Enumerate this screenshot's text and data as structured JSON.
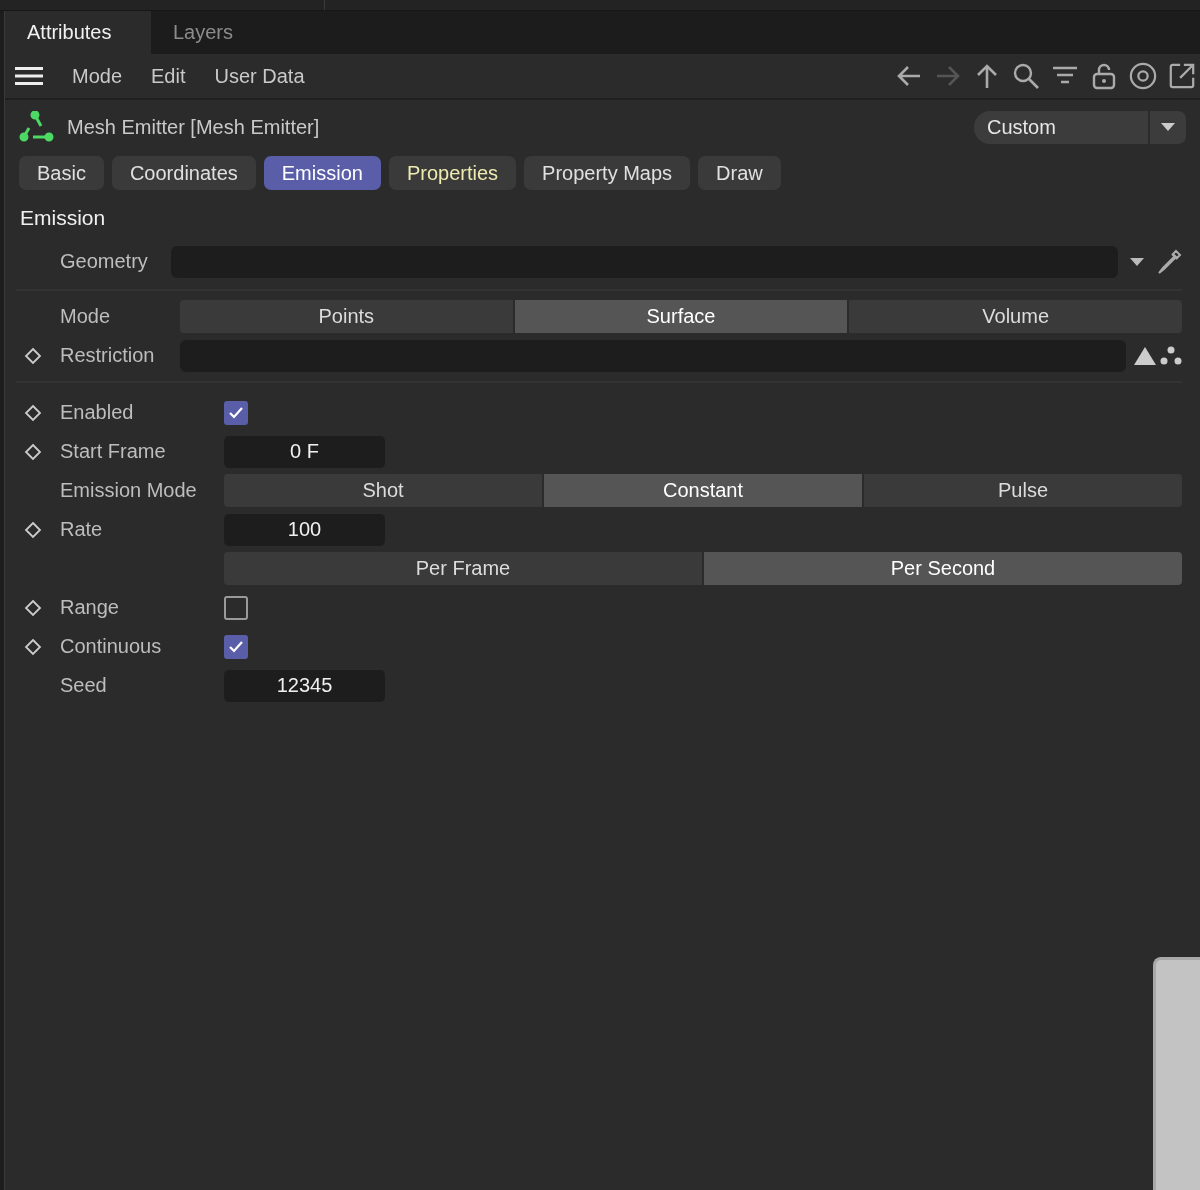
{
  "panel_tabs": [
    {
      "label": "Attributes",
      "selected": true
    },
    {
      "label": "Layers",
      "selected": false
    }
  ],
  "menu": [
    "Mode",
    "Edit",
    "User Data"
  ],
  "object": {
    "title": "Mesh Emitter [Mesh Emitter]",
    "preset": "Custom"
  },
  "tabs": [
    {
      "label": "Basic",
      "selected": false,
      "modified": false
    },
    {
      "label": "Coordinates",
      "selected": false,
      "modified": false
    },
    {
      "label": "Emission",
      "selected": true,
      "modified": false
    },
    {
      "label": "Properties",
      "selected": false,
      "modified": true
    },
    {
      "label": "Property Maps",
      "selected": false,
      "modified": false
    },
    {
      "label": "Draw",
      "selected": false,
      "modified": false
    }
  ],
  "section": "Emission",
  "groups": [
    [
      {
        "kind": "picker_link",
        "label": "Geometry",
        "keyframe": false
      },
      {
        "kind": "segmented",
        "label": "Mode",
        "keyframe": false,
        "options": [
          {
            "label": "Points",
            "selected": false
          },
          {
            "label": "Surface",
            "selected": true
          },
          {
            "label": "Volume",
            "selected": false
          }
        ]
      },
      {
        "kind": "restriction_link",
        "label": "Restriction",
        "keyframe": true
      }
    ],
    [
      {
        "kind": "checkbox",
        "label": "Enabled",
        "keyframe": true,
        "checked": true
      },
      {
        "kind": "number",
        "label": "Start Frame",
        "keyframe": true,
        "value": "0 F"
      },
      {
        "kind": "segmented",
        "label": "Emission Mode",
        "keyframe": false,
        "options": [
          {
            "label": "Shot",
            "selected": false
          },
          {
            "label": "Constant",
            "selected": true
          },
          {
            "label": "Pulse",
            "selected": false
          }
        ]
      },
      {
        "kind": "number",
        "label": "Rate",
        "keyframe": true,
        "value": "100"
      },
      {
        "kind": "segmented",
        "keyframe": false,
        "options": [
          {
            "label": "Per Frame",
            "selected": false
          },
          {
            "label": "Per Second",
            "selected": true
          }
        ]
      },
      {
        "kind": "checkbox",
        "label": "Range",
        "keyframe": true,
        "checked": false
      },
      {
        "kind": "checkbox",
        "label": "Continuous",
        "keyframe": true,
        "checked": true
      },
      {
        "kind": "number",
        "label": "Seed",
        "keyframe": false,
        "value": "12345"
      }
    ]
  ]
}
